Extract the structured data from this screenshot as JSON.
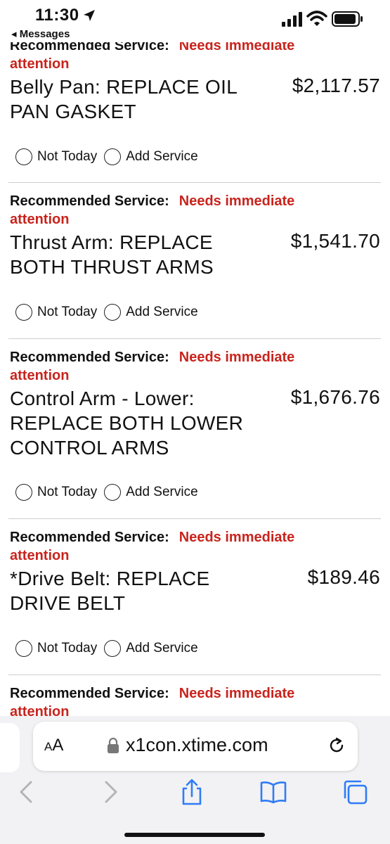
{
  "status_bar": {
    "time": "11:30",
    "back_label": "◂ Messages"
  },
  "services": [
    {
      "label": "Recommended Service:",
      "status_line1": "Needs immediate",
      "status_line2": "attention",
      "name": "Belly Pan: REPLACE OIL PAN GASKET",
      "price": "$2,117.57",
      "option1": "Not Today",
      "option2": "Add Service"
    },
    {
      "label": "Recommended Service:",
      "status_line1": "Needs immediate",
      "status_line2": "attention",
      "name": "Thrust Arm: REPLACE BOTH THRUST ARMS",
      "price": "$1,541.70",
      "option1": "Not Today",
      "option2": "Add Service"
    },
    {
      "label": "Recommended Service:",
      "status_line1": "Needs immediate",
      "status_line2": "attention",
      "name": "Control Arm - Lower: REPLACE BOTH LOWER CONTROL ARMS",
      "price": "$1,676.76",
      "option1": "Not Today",
      "option2": "Add Service"
    },
    {
      "label": "Recommended Service:",
      "status_line1": "Needs immediate",
      "status_line2": "attention",
      "name": "*Drive Belt: REPLACE DRIVE BELT",
      "price": "$189.46",
      "option1": "Not Today",
      "option2": "Add Service"
    },
    {
      "label": "Recommended Service:",
      "status_line1": "Needs immediate",
      "status_line2": "attention"
    }
  ],
  "browser": {
    "text_size_label": "AA",
    "url": "x1con.xtime.com"
  },
  "colors": {
    "alert_red": "#c8241d",
    "link_blue": "#2f7cf6"
  },
  "icons": {
    "location": "location-arrow-icon",
    "signal": "cellular-signal-icon",
    "wifi": "wifi-icon",
    "battery": "battery-icon",
    "lock": "lock-icon",
    "reload": "reload-icon",
    "back": "chevron-left-icon",
    "forward": "chevron-right-icon",
    "share": "share-icon",
    "bookmarks": "book-icon",
    "tabs": "tabs-icon"
  }
}
